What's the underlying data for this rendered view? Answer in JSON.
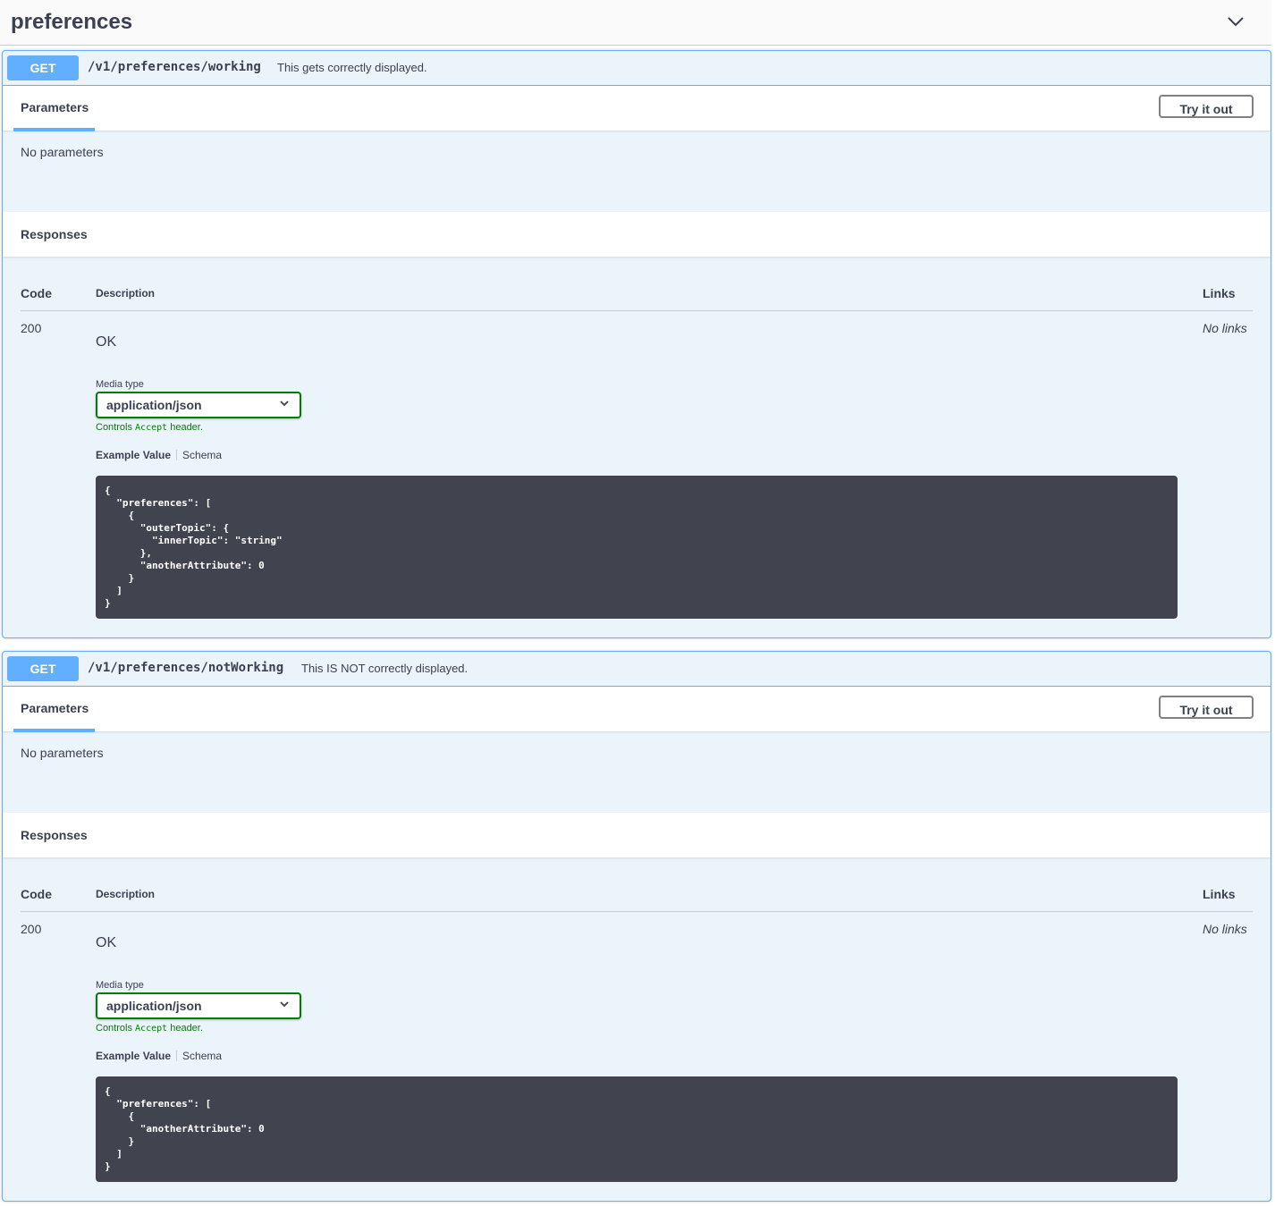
{
  "tag": {
    "title": "preferences",
    "toggle_icon": "chevron-down-icon"
  },
  "operations": [
    {
      "method": "GET",
      "path": "/v1/preferences/working",
      "summary": "This gets correctly displayed.",
      "parameters_tab": "Parameters",
      "try_button": "Try it out",
      "no_parameters": "No parameters",
      "responses_title": "Responses",
      "table_headers": {
        "code": "Code",
        "description": "Description",
        "links": "Links"
      },
      "response": {
        "code": "200",
        "description": "OK",
        "links": "No links",
        "media_type_label": "Media type",
        "media_type_value": "application/json",
        "controls_prefix": "Controls ",
        "controls_code": "Accept",
        "controls_suffix": " header.",
        "example_tab": "Example Value",
        "schema_tab": "Schema",
        "example": "{\n  \"preferences\": [\n    {\n      \"outerTopic\": {\n        \"innerTopic\": \"string\"\n      },\n      \"anotherAttribute\": 0\n    }\n  ]\n}"
      }
    },
    {
      "method": "GET",
      "path": "/v1/preferences/notWorking",
      "summary": "This IS NOT correctly displayed.",
      "parameters_tab": "Parameters",
      "try_button": "Try it out",
      "no_parameters": "No parameters",
      "responses_title": "Responses",
      "table_headers": {
        "code": "Code",
        "description": "Description",
        "links": "Links"
      },
      "response": {
        "code": "200",
        "description": "OK",
        "links": "No links",
        "media_type_label": "Media type",
        "media_type_value": "application/json",
        "controls_prefix": "Controls ",
        "controls_code": "Accept",
        "controls_suffix": " header.",
        "example_tab": "Example Value",
        "schema_tab": "Schema",
        "example": "{\n  \"preferences\": [\n    {\n      \"anotherAttribute\": 0\n    }\n  ]\n}"
      }
    }
  ],
  "colors": {
    "get": "#61affe",
    "block_bg": "#ebf3fb",
    "code_bg": "#41444e",
    "valid": "#008000"
  }
}
